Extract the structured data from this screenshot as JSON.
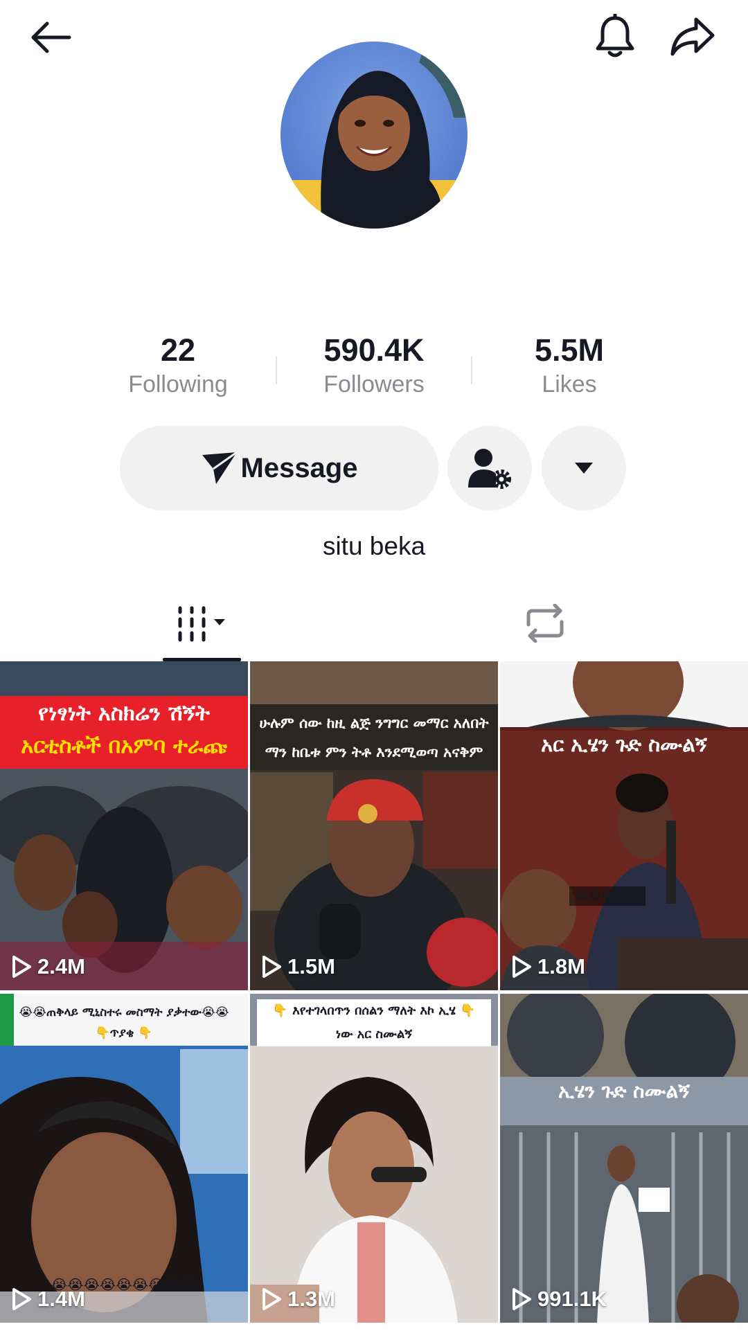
{
  "header": {
    "back_icon": "arrow-left-icon",
    "bell_icon": "bell-icon",
    "share_icon": "share-arrow-icon"
  },
  "stats": {
    "following": {
      "value": "22",
      "label": "Following"
    },
    "followers": {
      "value": "590.4K",
      "label": "Followers"
    },
    "likes": {
      "value": "5.5M",
      "label": "Likes"
    }
  },
  "actions": {
    "message_label": "Message",
    "message_icon": "send-plane-icon",
    "user_settings_icon": "user-gear-icon",
    "more_icon": "caret-down-icon"
  },
  "profile": {
    "display_name": "situ beka"
  },
  "tabs": [
    {
      "name": "videos",
      "icon": "grid-dropdown-icon",
      "active": true
    },
    {
      "name": "reposts",
      "icon": "repost-icon",
      "active": false
    }
  ],
  "videos": [
    {
      "views": "2.4M",
      "caption_lines": [
        "የነፃነት አስክሬን ሽኝት",
        "አርቲስቶች በአምባ ተራጩ"
      ]
    },
    {
      "views": "1.5M",
      "caption_lines": [
        "ሁሉም ሰው ከዚ ልጅ ንግግር መማር አለበት",
        "ማን ከቤቱ ምን ትቶ እንደሚወጣ አናቅም"
      ]
    },
    {
      "views": "1.8M",
      "caption_lines": [
        "አር ኢሄን ጉድ ስሙልኝ"
      ],
      "emoji": "😁😁😁😁😁"
    },
    {
      "views": "1.4M",
      "caption_lines": [
        "😭😭ጠቅላይ ሚኒስተሩ መስማት ያቃተው😭😭",
        "👇ጥያቄ 👇"
      ],
      "emoji": "😭😭😭😭😭😭😭😭😭"
    },
    {
      "views": "1.3M",
      "caption_lines": [
        "👇 እየተገላበጥን በሰልን ማለት እኮ ኢሄ 👇",
        "ነው አር ስሙልኝ"
      ]
    },
    {
      "views": "991.1K",
      "caption_lines": [
        "ኢሄን ጉድ ስሙልኝ"
      ]
    }
  ],
  "colors": {
    "text": "#161823",
    "muted": "#8a8b91",
    "button_bg": "#f1f1f2",
    "caption_red": "#e8202a",
    "caption_yellow": "#ffe100"
  }
}
